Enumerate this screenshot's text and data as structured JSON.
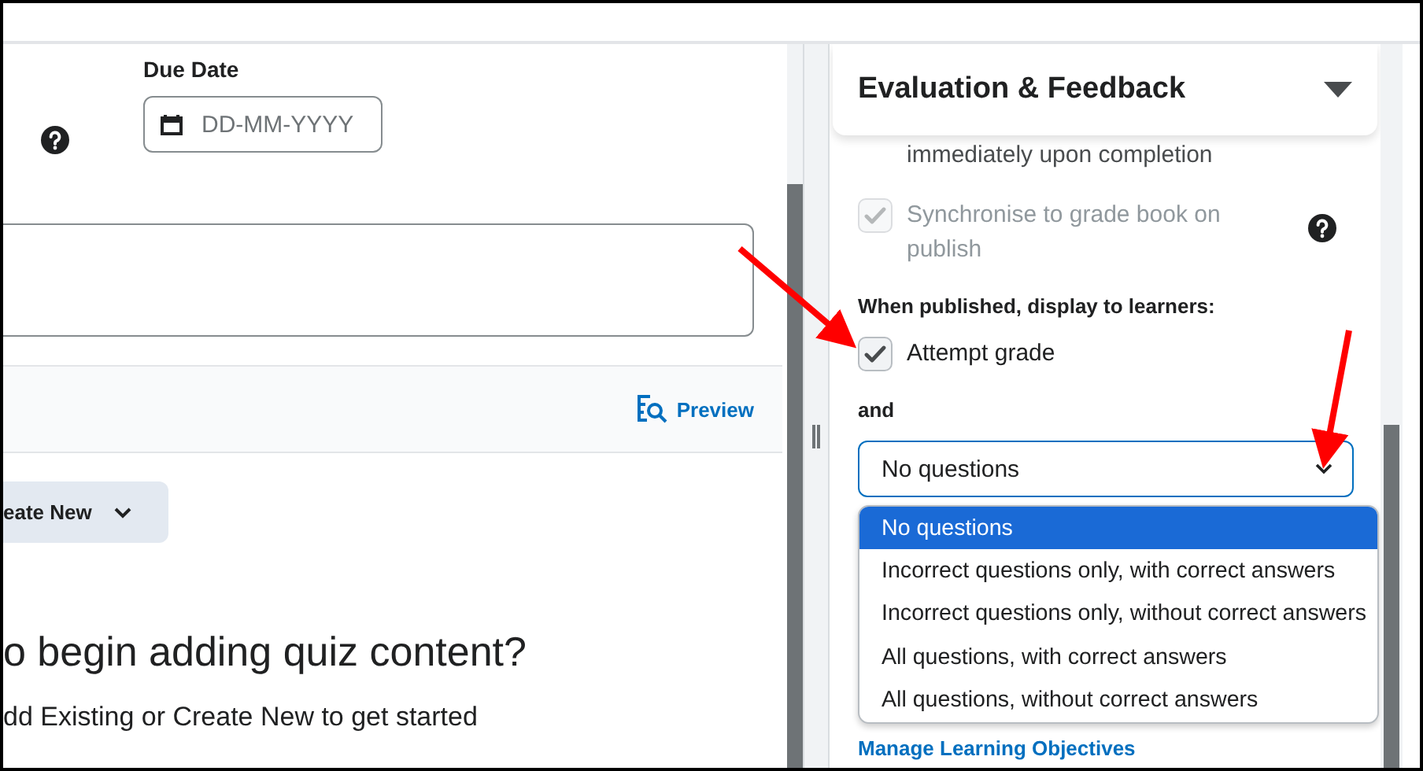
{
  "left_panel": {
    "due_date": {
      "label": "Due Date",
      "placeholder": "DD-MM-YYYY"
    },
    "preview_link": "Preview",
    "create_button": "eate New",
    "heading": "o begin adding quiz content?",
    "hint": "dd Existing or Create New to get started"
  },
  "right_panel": {
    "section": {
      "title": "Evaluation & Feedback",
      "expanded": true
    },
    "options": [
      {
        "kind": "text",
        "label": "immediately upon completion"
      },
      {
        "kind": "checkbox",
        "label": "Synchronise to grade book on publish",
        "checked": true,
        "disabled": true,
        "help": true
      }
    ],
    "display_heading": "When published, display to learners:",
    "attempt_grade": {
      "label": "Attempt grade",
      "checked": true
    },
    "and_label": "and",
    "select": {
      "value": "No questions",
      "open": true,
      "options": [
        {
          "label": "No questions",
          "selected": true
        },
        {
          "label": "Incorrect questions only, with correct answers",
          "selected": false
        },
        {
          "label": "Incorrect questions only, without correct answers",
          "selected": false
        },
        {
          "label": "All questions, with correct answers",
          "selected": false
        },
        {
          "label": "All questions, without correct answers",
          "selected": false
        }
      ]
    },
    "link": "Manage Learning Objectives"
  }
}
